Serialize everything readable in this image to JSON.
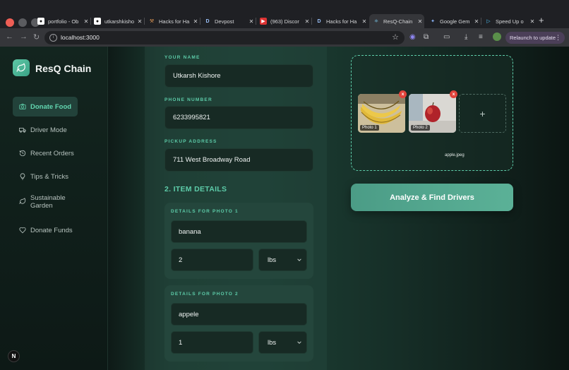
{
  "browser": {
    "tabs": [
      {
        "label": "portfolio - Ob",
        "icon": "github-icon"
      },
      {
        "label": "utkarshkisho",
        "icon": "github-icon"
      },
      {
        "label": "Hacks for Ha",
        "icon": "wrench-icon"
      },
      {
        "label": "Devpost",
        "icon": "devpost-icon"
      },
      {
        "label": "(963) Discor",
        "icon": "youtube-icon"
      },
      {
        "label": "Hacks for Ha",
        "icon": "devpost-icon"
      },
      {
        "label": "ResQ-Chain",
        "icon": "react-icon"
      },
      {
        "label": "Google Gem",
        "icon": "gemini-icon"
      },
      {
        "label": "Speed Up o",
        "icon": "play-icon"
      }
    ],
    "active_tab_index": 6,
    "url": "localhost:3000",
    "relaunch_label": "Relaunch to update",
    "colors": {
      "relaunch_bg": "#4b3f58"
    }
  },
  "sidebar": {
    "brand": "ResQ Chain",
    "items": [
      {
        "label": "Donate Food",
        "icon": "camera-icon",
        "active": true
      },
      {
        "label": "Driver Mode",
        "icon": "truck-icon",
        "active": false
      },
      {
        "label": "Recent Orders",
        "icon": "history-icon",
        "active": false
      },
      {
        "label": "Tips & Tricks",
        "icon": "lightbulb-icon",
        "active": false
      },
      {
        "label": "Sustainable Garden",
        "icon": "leaf-icon",
        "active": false
      },
      {
        "label": "Donate Funds",
        "icon": "heart-icon",
        "active": false
      }
    ],
    "badge": "N"
  },
  "form": {
    "name_label": "YOUR NAME",
    "name_value": "Utkarsh Kishore",
    "phone_label": "PHONE NUMBER",
    "phone_value": "6233995821",
    "address_label": "PICKUP ADDRESS",
    "address_value": "711 West Broadway Road",
    "section_title": "2. ITEM DETAILS",
    "items": [
      {
        "label": "DETAILS FOR PHOTO 1",
        "name": "banana",
        "quantity": "2",
        "unit": "lbs"
      },
      {
        "label": "DETAILS FOR PHOTO 2",
        "name": "appele",
        "quantity": "1",
        "unit": "lbs"
      }
    ]
  },
  "photos": {
    "items": [
      {
        "tag": "Photo 1",
        "remove": "x"
      },
      {
        "tag": "Photo 2",
        "remove": "x"
      }
    ],
    "add_label": "+",
    "filename": "apple.jpeg"
  },
  "actions": {
    "analyze_label": "Analyze & Find Drivers"
  },
  "colors": {
    "accent": "#5dcca9",
    "remove_red": "#e0433b"
  }
}
